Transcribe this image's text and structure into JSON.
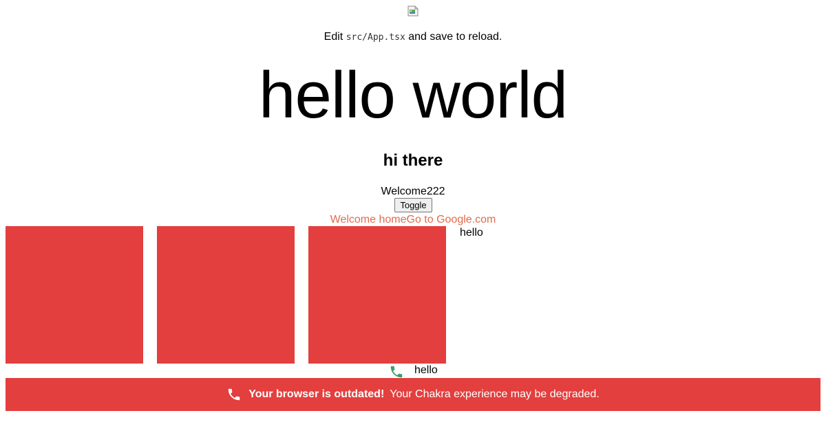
{
  "header": {
    "logo_icon": "broken-image-icon",
    "edit_prefix": "Edit",
    "edit_code": "src/App.tsx",
    "edit_suffix": "and save to reload."
  },
  "main": {
    "hero_title": "hello world",
    "subtitle": "hi there",
    "welcome_text": "Welcome222",
    "toggle_label": "Toggle",
    "welcome_home_link": "Welcome home",
    "google_link": "Go to Google.com",
    "boxes": [
      "",
      "",
      ""
    ],
    "hello_side": "hello",
    "hello_bottom": "hello",
    "phone_icon": "phone-icon"
  },
  "alert": {
    "icon": "phone-icon",
    "title": "Your browser is outdated!",
    "description": "Your Chakra experience may be degraded."
  },
  "colors": {
    "box_red": "#e33f3e",
    "link_orange": "#e36a4b",
    "phone_green": "#38a169",
    "alert_bg": "#e33f3e"
  }
}
